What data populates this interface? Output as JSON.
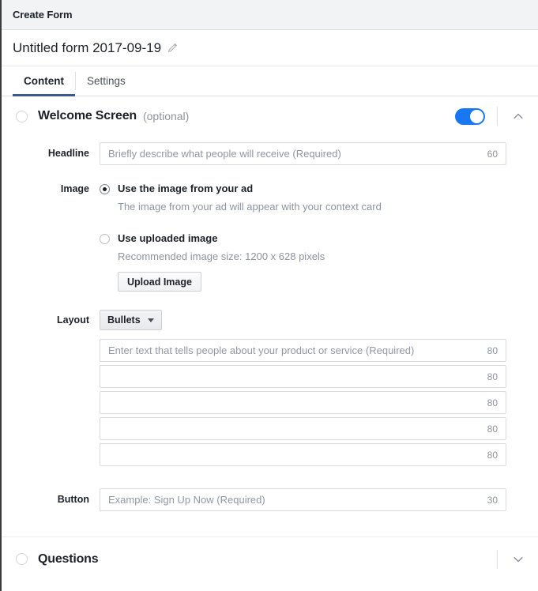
{
  "titlebar": {
    "title": "Create Form"
  },
  "form": {
    "name": "Untitled form 2017-09-19",
    "edit_icon": "pencil-icon"
  },
  "tabs": [
    {
      "label": "Content",
      "active": true
    },
    {
      "label": "Settings",
      "active": false
    }
  ],
  "welcome_section": {
    "title": "Welcome Screen",
    "optional_label": "(optional)",
    "toggle_on": true,
    "collapse_icon": "chevron-up-icon",
    "headline": {
      "label": "Headline",
      "placeholder": "Briefly describe what people will receive (Required)",
      "value": "",
      "counter": "60"
    },
    "image": {
      "label": "Image",
      "options": [
        {
          "title": "Use the image from your ad",
          "subtitle": "The image from your ad will appear with your context card",
          "selected": true
        },
        {
          "title": "Use uploaded image",
          "subtitle": "Recommended image size: 1200 x 628 pixels",
          "selected": false
        }
      ],
      "upload_button": "Upload Image"
    },
    "layout": {
      "label": "Layout",
      "selected": "Bullets",
      "dropdown_icon": "chevron-down-icon",
      "bullets": [
        {
          "placeholder": "Enter text that tells people about your product or service (Required)",
          "value": "",
          "counter": "80"
        },
        {
          "placeholder": "",
          "value": "",
          "counter": "80"
        },
        {
          "placeholder": "",
          "value": "",
          "counter": "80"
        },
        {
          "placeholder": "",
          "value": "",
          "counter": "80"
        },
        {
          "placeholder": "",
          "value": "",
          "counter": "80"
        }
      ]
    },
    "button": {
      "label": "Button",
      "placeholder": "Example: Sign Up Now (Required)",
      "value": "",
      "counter": "30"
    }
  },
  "questions_section": {
    "title": "Questions",
    "expand_icon": "chevron-down-icon"
  },
  "colors": {
    "accent_blue": "#1877f2",
    "tab_underline": "#3b5998",
    "header_bg": "#f2f3f5",
    "border": "#dddfe2",
    "muted_text": "#8d949e"
  }
}
